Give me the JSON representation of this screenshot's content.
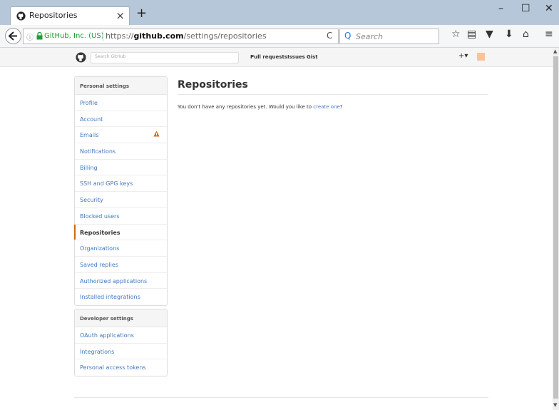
{
  "browser": {
    "tab_title": "Repositories",
    "url_site_identity": "GitHub, Inc. (US)",
    "url_prefix": "https://",
    "url_domain": "github.com",
    "url_path": "/settings/repositories",
    "search_placeholder": "Search",
    "window_controls": [
      "–",
      "☐",
      "✕"
    ]
  },
  "header": {
    "search_placeholder": "Search GitHub",
    "nav": [
      "Pull requests",
      "Issues",
      "Gist"
    ]
  },
  "sidebar": {
    "personal_heading": "Personal settings",
    "personal_items": [
      {
        "label": "Profile"
      },
      {
        "label": "Account"
      },
      {
        "label": "Emails",
        "warning": true
      },
      {
        "label": "Notifications"
      },
      {
        "label": "Billing"
      },
      {
        "label": "SSH and GPG keys"
      },
      {
        "label": "Security"
      },
      {
        "label": "Blocked users"
      },
      {
        "label": "Repositories",
        "selected": true
      },
      {
        "label": "Organizations"
      },
      {
        "label": "Saved replies"
      },
      {
        "label": "Authorized applications"
      },
      {
        "label": "Installed integrations"
      }
    ],
    "developer_heading": "Developer settings",
    "developer_items": [
      {
        "label": "OAuth applications"
      },
      {
        "label": "Integrations"
      },
      {
        "label": "Personal access tokens"
      }
    ]
  },
  "main": {
    "title": "Repositories",
    "message_before": "You don't have any repositories yet. Would you like to ",
    "message_link": "create one",
    "message_after": "?"
  },
  "colors": {
    "link": "#4078c0",
    "selected_marker": "#d26911",
    "warning": "#d26911"
  }
}
